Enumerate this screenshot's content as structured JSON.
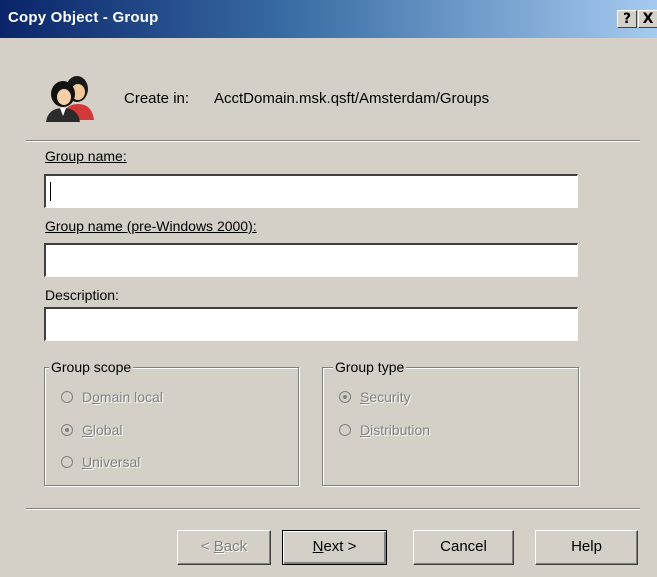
{
  "window": {
    "title": "Copy Object - Group",
    "help_button": "?",
    "close_button": "X"
  },
  "header": {
    "icon": "group-users-icon",
    "create_in_label": "Create in:",
    "create_in_path": "AcctDomain.msk.qsft/Amsterdam/Groups"
  },
  "form": {
    "group_name": {
      "label": "Group name:",
      "value": ""
    },
    "group_name_pre2000": {
      "label": "Group name (pre-Windows 2000):",
      "value": ""
    },
    "description": {
      "label": "Description:",
      "value": ""
    }
  },
  "group_scope": {
    "title": "Group scope",
    "options": [
      {
        "label_pre": "D",
        "accel": "o",
        "label_post": "main local",
        "checked": false,
        "enabled": false
      },
      {
        "label_pre": "",
        "accel": "G",
        "label_post": "lobal",
        "checked": true,
        "enabled": false
      },
      {
        "label_pre": "",
        "accel": "U",
        "label_post": "niversal",
        "checked": false,
        "enabled": false
      }
    ]
  },
  "group_type": {
    "title": "Group type",
    "options": [
      {
        "label_pre": "",
        "accel": "S",
        "label_post": "ecurity",
        "checked": true,
        "enabled": false
      },
      {
        "label_pre": "",
        "accel": "D",
        "label_post": "istribution",
        "checked": false,
        "enabled": false
      }
    ]
  },
  "buttons": {
    "back": {
      "pre": "< ",
      "accel": "B",
      "post": "ack",
      "enabled": false
    },
    "next": {
      "pre": "",
      "accel": "N",
      "post": "ext >",
      "enabled": true
    },
    "cancel": {
      "label": "Cancel"
    },
    "help": {
      "label": "Help"
    }
  },
  "colors": {
    "titlebar_start": "#0a246a",
    "titlebar_end": "#a6caf0",
    "dialog_face": "#d4d0c8",
    "disabled_text": "#808080"
  }
}
